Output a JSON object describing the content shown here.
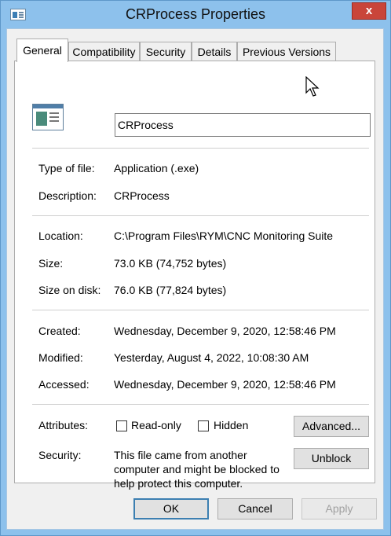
{
  "window": {
    "title": "CRProcess Properties",
    "close_glyph": "x"
  },
  "tabs": [
    {
      "label": "General",
      "active": true
    },
    {
      "label": "Compatibility",
      "active": false
    },
    {
      "label": "Security",
      "active": false
    },
    {
      "label": "Details",
      "active": false
    },
    {
      "label": "Previous Versions",
      "active": false
    }
  ],
  "file": {
    "icon": "application-window-icon",
    "name": "CRProcess"
  },
  "info": {
    "type_label": "Type of file:",
    "type_value": "Application (.exe)",
    "description_label": "Description:",
    "description_value": "CRProcess",
    "location_label": "Location:",
    "location_value": "C:\\Program Files\\RYM\\CNC Monitoring Suite",
    "size_label": "Size:",
    "size_value": "73.0 KB (74,752 bytes)",
    "size_on_disk_label": "Size on disk:",
    "size_on_disk_value": "76.0 KB (77,824 bytes)",
    "created_label": "Created:",
    "created_value": "Wednesday, December 9, 2020, 12:58:46 PM",
    "modified_label": "Modified:",
    "modified_value": "Yesterday, August 4, 2022, 10:08:30 AM",
    "accessed_label": "Accessed:",
    "accessed_value": "Wednesday, December 9, 2020, 12:58:46 PM"
  },
  "attributes": {
    "label": "Attributes:",
    "readonly_label": "Read-only",
    "readonly_checked": false,
    "hidden_label": "Hidden",
    "hidden_checked": false,
    "advanced_label": "Advanced..."
  },
  "security": {
    "label": "Security:",
    "message": "This file came from another computer and might be blocked to help protect this computer.",
    "unblock_label": "Unblock"
  },
  "footer": {
    "ok_label": "OK",
    "cancel_label": "Cancel",
    "apply_label": "Apply"
  },
  "colors": {
    "window_frame": "#8dc1ec",
    "close_button": "#c9453a"
  }
}
